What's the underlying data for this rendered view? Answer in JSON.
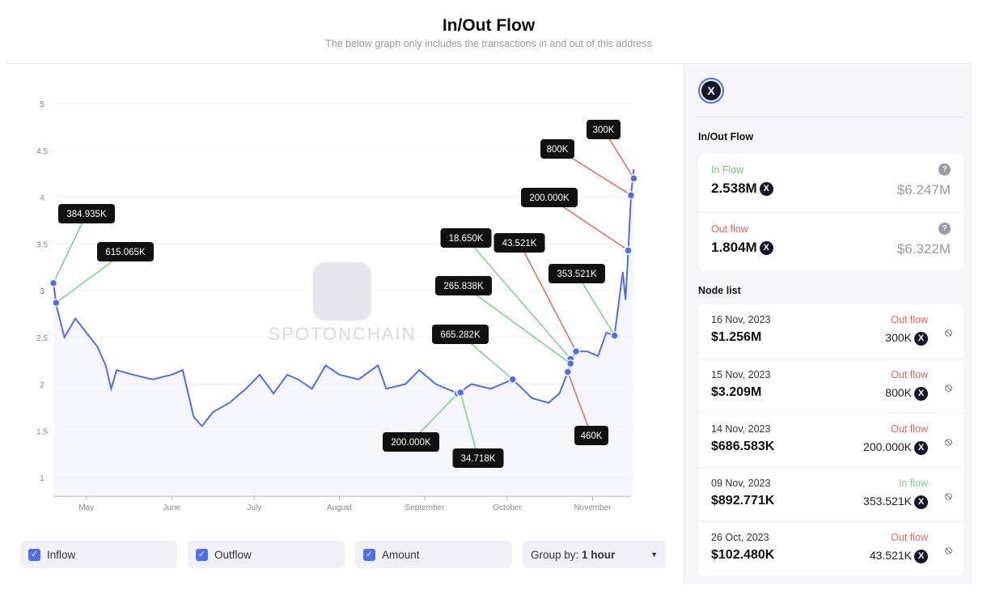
{
  "header": {
    "title": "In/Out Flow",
    "subtitle": "The below graph only includes the transactions in and out of this address"
  },
  "watermark": "SPOTONCHAIN",
  "colors": {
    "line": "#4f6ee8",
    "inflow": "#7ccf8c",
    "outflow": "#e06a5f",
    "accent": "#4f6ee8"
  },
  "chart_data": {
    "type": "line",
    "yticks": [
      1,
      1.5,
      2,
      2.5,
      3,
      3.5,
      4,
      4.5,
      5
    ],
    "ylim": [
      1,
      5
    ],
    "xticks": [
      {
        "label": "May",
        "date": "2023-05-01"
      },
      {
        "label": "June",
        "date": "2023-06-01"
      },
      {
        "label": "July",
        "date": "2023-07-01"
      },
      {
        "label": "August",
        "date": "2023-08-01"
      },
      {
        "label": "September",
        "date": "2023-09-01"
      },
      {
        "label": "October",
        "date": "2023-10-01"
      },
      {
        "label": "November",
        "date": "2023-11-01"
      }
    ],
    "series": [
      {
        "points": [
          [
            "2023-04-19",
            3.1
          ],
          [
            "2023-04-20",
            2.85
          ],
          [
            "2023-04-23",
            2.5
          ],
          [
            "2023-04-27",
            2.7
          ],
          [
            "2023-05-01",
            2.55
          ],
          [
            "2023-05-05",
            2.4
          ],
          [
            "2023-05-08",
            2.2
          ],
          [
            "2023-05-10",
            1.95
          ],
          [
            "2023-05-12",
            2.15
          ],
          [
            "2023-05-18",
            2.1
          ],
          [
            "2023-05-25",
            2.05
          ],
          [
            "2023-06-01",
            2.1
          ],
          [
            "2023-06-05",
            2.15
          ],
          [
            "2023-06-09",
            1.65
          ],
          [
            "2023-06-12",
            1.55
          ],
          [
            "2023-06-16",
            1.7
          ],
          [
            "2023-06-22",
            1.8
          ],
          [
            "2023-06-28",
            1.95
          ],
          [
            "2023-07-03",
            2.1
          ],
          [
            "2023-07-08",
            1.9
          ],
          [
            "2023-07-13",
            2.1
          ],
          [
            "2023-07-17",
            2.05
          ],
          [
            "2023-07-22",
            1.95
          ],
          [
            "2023-07-27",
            2.2
          ],
          [
            "2023-08-01",
            2.1
          ],
          [
            "2023-08-08",
            2.05
          ],
          [
            "2023-08-15",
            2.2
          ],
          [
            "2023-08-18",
            1.95
          ],
          [
            "2023-08-25",
            2.0
          ],
          [
            "2023-08-30",
            2.15
          ],
          [
            "2023-09-05",
            2.0
          ],
          [
            "2023-09-13",
            1.9
          ],
          [
            "2023-09-18",
            2.0
          ],
          [
            "2023-09-25",
            1.95
          ],
          [
            "2023-10-03",
            2.05
          ],
          [
            "2023-10-10",
            1.85
          ],
          [
            "2023-10-16",
            1.8
          ],
          [
            "2023-10-20",
            1.9
          ],
          [
            "2023-10-23",
            2.13
          ],
          [
            "2023-10-24",
            2.24
          ],
          [
            "2023-10-26",
            2.35
          ],
          [
            "2023-10-30",
            2.35
          ],
          [
            "2023-11-03",
            2.3
          ],
          [
            "2023-11-06",
            2.55
          ],
          [
            "2023-11-09",
            2.52
          ],
          [
            "2023-11-12",
            3.2
          ],
          [
            "2023-11-13",
            2.9
          ],
          [
            "2023-11-14",
            3.43
          ],
          [
            "2023-11-15",
            4.02
          ],
          [
            "2023-11-16",
            4.3
          ]
        ]
      }
    ],
    "annotations": [
      {
        "label": "384.935K",
        "date": "2023-04-19",
        "value": 3.08,
        "type": "in"
      },
      {
        "label": "615.065K",
        "date": "2023-04-20",
        "value": 2.87,
        "type": "in"
      },
      {
        "label": "18.650K",
        "date": "2023-10-24",
        "value": 2.27,
        "type": "in"
      },
      {
        "label": "43.521K",
        "date": "2023-10-26",
        "value": 2.35,
        "type": "out"
      },
      {
        "label": "265.838K",
        "date": "2023-10-24",
        "value": 2.22,
        "type": "in"
      },
      {
        "label": "665.282K",
        "date": "2023-10-03",
        "value": 2.05,
        "type": "in"
      },
      {
        "label": "200.000K",
        "date": "2023-09-13",
        "value": 1.9,
        "type": "in"
      },
      {
        "label": "34.718K",
        "date": "2023-09-14",
        "value": 1.91,
        "type": "in"
      },
      {
        "label": "460K",
        "date": "2023-10-23",
        "value": 2.13,
        "type": "out"
      },
      {
        "label": "353.521K",
        "date": "2023-11-09",
        "value": 2.52,
        "type": "in"
      },
      {
        "label": "200.000K",
        "date": "2023-11-14",
        "value": 3.43,
        "type": "out"
      },
      {
        "label": "800K",
        "date": "2023-11-15",
        "value": 4.02,
        "type": "out"
      },
      {
        "label": "300K",
        "date": "2023-11-16",
        "value": 4.2,
        "type": "out"
      }
    ]
  },
  "controls": {
    "inflow": "Inflow",
    "outflow": "Outflow",
    "amount": "Amount",
    "group_by_label": "Group by:",
    "group_by_value": "1 hour"
  },
  "panel": {
    "token_icon": "x-token-icon",
    "flow_title": "In/Out Flow",
    "inflow": {
      "label": "In Flow",
      "amount": "2.538M",
      "usd": "$6.247M"
    },
    "outflow": {
      "label": "Out flow",
      "amount": "1.804M",
      "usd": "$6.322M"
    },
    "node_title": "Node list",
    "nodes": [
      {
        "date": "16 Nov, 2023",
        "usd": "$1.256M",
        "type": "Out flow",
        "amount": "300K"
      },
      {
        "date": "15 Nov, 2023",
        "usd": "$3.209M",
        "type": "Out flow",
        "amount": "800K"
      },
      {
        "date": "14 Nov, 2023",
        "usd": "$686.583K",
        "type": "Out flow",
        "amount": "200.000K"
      },
      {
        "date": "09 Nov, 2023",
        "usd": "$892.771K",
        "type": "In flow",
        "amount": "353.521K"
      },
      {
        "date": "26 Oct, 2023",
        "usd": "$102.480K",
        "type": "Out flow",
        "amount": "43.521K"
      }
    ]
  }
}
